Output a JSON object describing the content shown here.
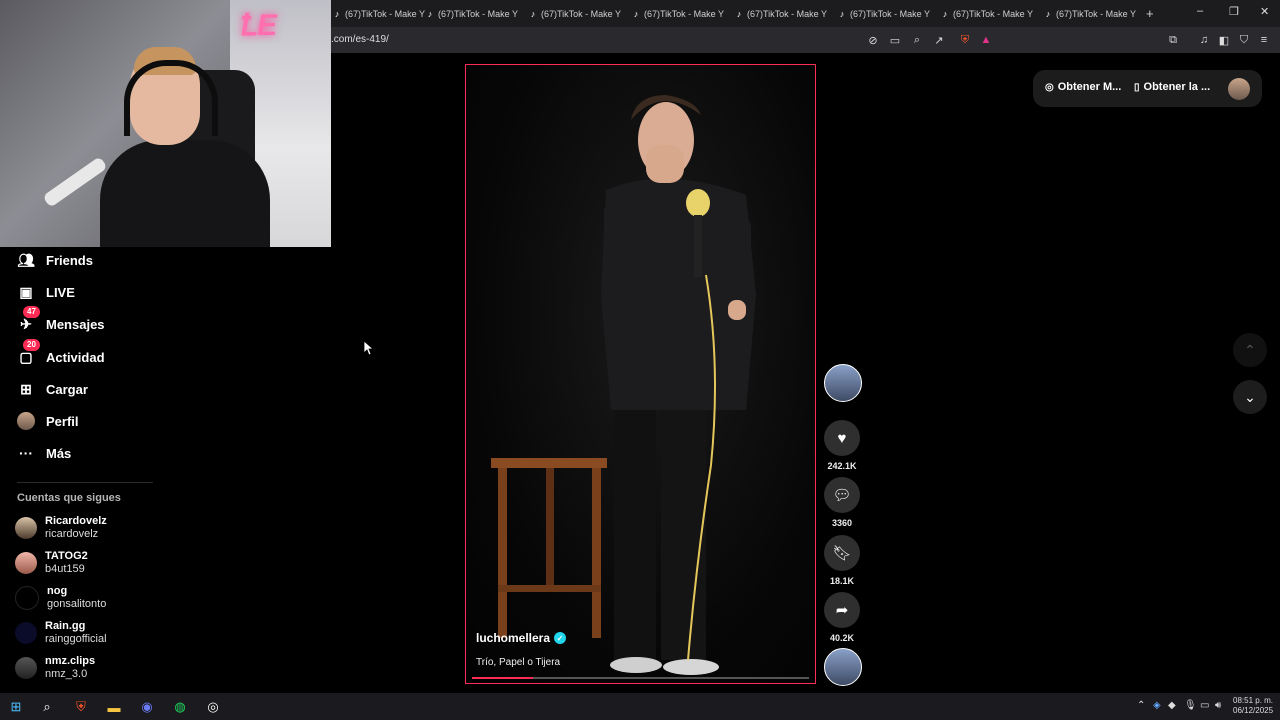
{
  "browser": {
    "tabs": [
      {
        "label": "(67)TikTok - Make Y"
      },
      {
        "label": "(67)TikTok - Make Y"
      },
      {
        "label": "(67)TikTok - Make Y"
      },
      {
        "label": "(67)TikTok - Make Y"
      },
      {
        "label": "(67)TikTok - Make Y"
      },
      {
        "label": "(67)TikTok - Make Y"
      },
      {
        "label": "(67)TikTok - Make Y"
      },
      {
        "label": "(67)TikTok - Make Y"
      }
    ],
    "new_tab": "+",
    "window_controls": {
      "minimize": "–",
      "restore": "❐",
      "close": "✕"
    },
    "url": ".com/es-419/"
  },
  "sidebar": {
    "items": [
      {
        "label": "Friends",
        "icon": "friends-icon"
      },
      {
        "label": "LIVE",
        "icon": "live-icon"
      },
      {
        "label": "Mensajes",
        "icon": "messages-icon",
        "badge": "47"
      },
      {
        "label": "Actividad",
        "icon": "activity-icon",
        "badge": "20"
      },
      {
        "label": "Cargar",
        "icon": "upload-icon"
      },
      {
        "label": "Perfil",
        "icon": "profile-avatar"
      },
      {
        "label": "Más",
        "icon": "more-icon"
      }
    ],
    "following_title": "Cuentas que sigues",
    "following": [
      {
        "name": "Ricardovelz",
        "handle": "ricardovelz"
      },
      {
        "name": "TATOG2",
        "handle": "b4ut159"
      },
      {
        "name": "nog",
        "handle": "gonsalitonto"
      },
      {
        "name": "Rain.gg",
        "handle": "rainggofficial"
      },
      {
        "name": "nmz.clips",
        "handle": "nmz_3.0"
      }
    ]
  },
  "video": {
    "creator": "luchomellera",
    "caption": "Trío, Papel o Tijera",
    "progress": 0.18
  },
  "actions": {
    "likes": "242.1K",
    "comments": "3360",
    "saves": "18.1K",
    "shares": "40.2K"
  },
  "header": {
    "get_coins": "Obtener M...",
    "get_app": "Obtener la ..."
  },
  "taskbar": {
    "time": "08:51 p. m.",
    "date": "06/12/2025"
  },
  "colors": {
    "accent": "#fe2c55",
    "verified": "#20d5ec",
    "background": "#000000"
  }
}
